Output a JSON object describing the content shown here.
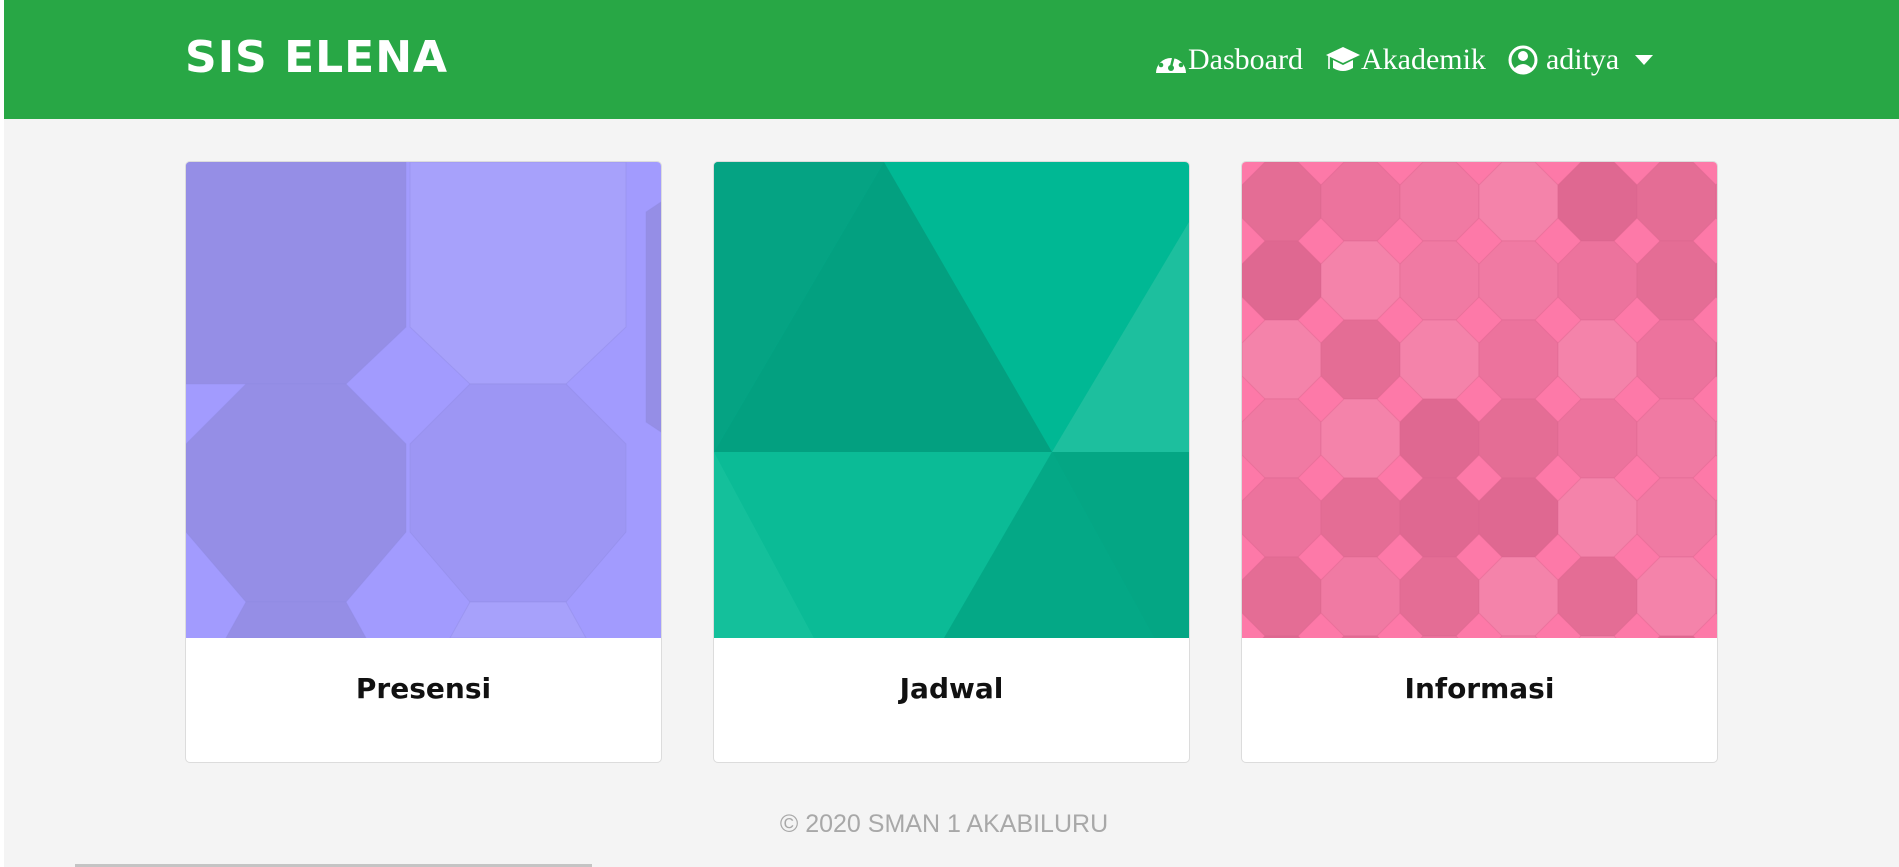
{
  "navbar": {
    "brand": "SIS ELENA",
    "links": [
      {
        "label": "Dasboard",
        "icon": "tachometer-icon"
      },
      {
        "label": "Akademik",
        "icon": "graduation-cap-icon"
      },
      {
        "label": "aditya",
        "icon": "user-circle-icon"
      }
    ],
    "color": "#28a745"
  },
  "cards": [
    {
      "title": "Presensi",
      "color": "#a29bfe"
    },
    {
      "title": "Jadwal",
      "color": "#00b894"
    },
    {
      "title": "Informasi",
      "color": "#fd79a8"
    }
  ],
  "footer": {
    "text": "© 2020 SMAN 1 AKABILURU"
  }
}
